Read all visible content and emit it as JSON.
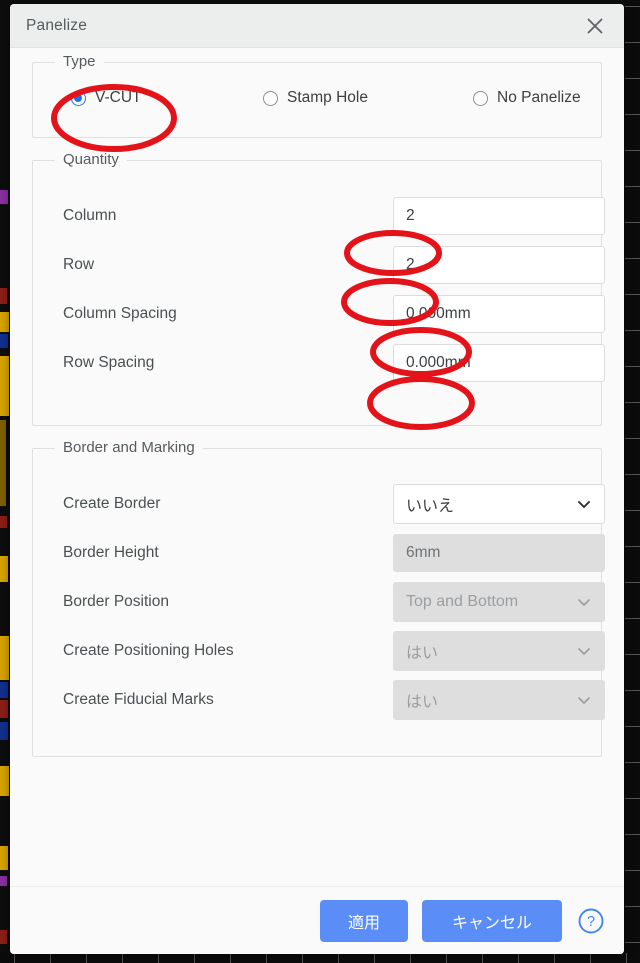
{
  "dialog": {
    "title": "Panelize",
    "close_icon": "close-icon"
  },
  "type_group": {
    "legend": "Type",
    "options": [
      {
        "label": "V-CUT",
        "selected": true
      },
      {
        "label": "Stamp Hole",
        "selected": false
      },
      {
        "label": "No Panelize",
        "selected": false
      }
    ]
  },
  "quantity_group": {
    "legend": "Quantity",
    "fields": [
      {
        "label": "Column",
        "value": "2",
        "disabled": false
      },
      {
        "label": "Row",
        "value": "2",
        "disabled": false
      },
      {
        "label": "Column Spacing",
        "value": "0.000mm",
        "disabled": false
      },
      {
        "label": "Row Spacing",
        "value": "0.000mm",
        "disabled": false
      }
    ]
  },
  "border_group": {
    "legend": "Border and Marking",
    "fields": [
      {
        "label": "Create Border",
        "value": "いいえ",
        "kind": "select",
        "disabled": false
      },
      {
        "label": "Border Height",
        "value": "6mm",
        "kind": "input",
        "disabled": true
      },
      {
        "label": "Border Position",
        "value": "Top and Bottom",
        "kind": "select",
        "disabled": true
      },
      {
        "label": "Create Positioning Holes",
        "value": "はい",
        "kind": "select",
        "disabled": true
      },
      {
        "label": "Create Fiducial Marks",
        "value": "はい",
        "kind": "select",
        "disabled": true
      }
    ]
  },
  "footer": {
    "apply_label": "適用",
    "cancel_label": "キャンセル",
    "help_icon": "help-circle-icon"
  },
  "colors": {
    "accent_blue": "#5b8df6",
    "radio_blue": "#1a73e8",
    "annotation_red": "#e4131a",
    "titlebar_bg": "#eceded",
    "dialog_bg": "#fafafa",
    "disabled_bg": "#dedede"
  }
}
